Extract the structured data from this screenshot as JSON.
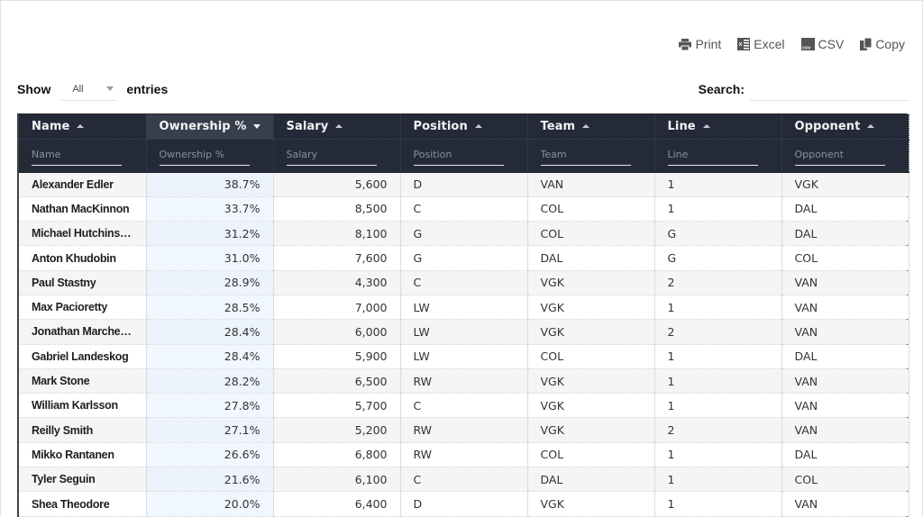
{
  "toolbar": {
    "buttons": [
      {
        "label": "Print",
        "icon": "printer-icon"
      },
      {
        "label": "Excel",
        "icon": "excel-file-icon"
      },
      {
        "label": "CSV",
        "icon": "csv-file-icon"
      },
      {
        "label": "Copy",
        "icon": "copy-icon"
      }
    ]
  },
  "length": {
    "show_label": "Show",
    "selected": "All",
    "entries_label": "entries"
  },
  "search": {
    "label": "Search:",
    "value": ""
  },
  "table": {
    "columns": [
      {
        "title": "Name",
        "filter_placeholder": "Name",
        "sort": "asc"
      },
      {
        "title": "Ownership %",
        "filter_placeholder": "Ownership %",
        "sort": "desc"
      },
      {
        "title": "Salary",
        "filter_placeholder": "Salary",
        "sort": "asc"
      },
      {
        "title": "Position",
        "filter_placeholder": "Position",
        "sort": "asc"
      },
      {
        "title": "Team",
        "filter_placeholder": "Team",
        "sort": "asc"
      },
      {
        "title": "Line",
        "filter_placeholder": "Line",
        "sort": "asc"
      },
      {
        "title": "Opponent",
        "filter_placeholder": "Opponent",
        "sort": "asc"
      }
    ],
    "rows": [
      [
        "Alexander Edler",
        "38.7%",
        "5,600",
        "D",
        "VAN",
        "1",
        "VGK"
      ],
      [
        "Nathan MacKinnon",
        "33.7%",
        "8,500",
        "C",
        "COL",
        "1",
        "DAL"
      ],
      [
        "Michael Hutchinson",
        "31.2%",
        "8,100",
        "G",
        "COL",
        "G",
        "DAL"
      ],
      [
        "Anton Khudobin",
        "31.0%",
        "7,600",
        "G",
        "DAL",
        "G",
        "COL"
      ],
      [
        "Paul Stastny",
        "28.9%",
        "4,300",
        "C",
        "VGK",
        "2",
        "VAN"
      ],
      [
        "Max Pacioretty",
        "28.5%",
        "7,000",
        "LW",
        "VGK",
        "1",
        "VAN"
      ],
      [
        "Jonathan Marchess...",
        "28.4%",
        "6,000",
        "LW",
        "VGK",
        "2",
        "VAN"
      ],
      [
        "Gabriel Landeskog",
        "28.4%",
        "5,900",
        "LW",
        "COL",
        "1",
        "DAL"
      ],
      [
        "Mark Stone",
        "28.2%",
        "6,500",
        "RW",
        "VGK",
        "1",
        "VAN"
      ],
      [
        "William Karlsson",
        "27.8%",
        "5,700",
        "C",
        "VGK",
        "1",
        "VAN"
      ],
      [
        "Reilly Smith",
        "27.1%",
        "5,200",
        "RW",
        "VGK",
        "2",
        "VAN"
      ],
      [
        "Mikko Rantanen",
        "26.6%",
        "6,800",
        "RW",
        "COL",
        "1",
        "DAL"
      ],
      [
        "Tyler Seguin",
        "21.6%",
        "6,100",
        "C",
        "DAL",
        "1",
        "COL"
      ],
      [
        "Shea Theodore",
        "20.0%",
        "6,400",
        "D",
        "VGK",
        "1",
        "VAN"
      ]
    ]
  },
  "colors": {
    "header_bg": "#242a38",
    "sorted_header_bg": "#373e4c",
    "sorted_column_tint": "#eef5fd"
  }
}
